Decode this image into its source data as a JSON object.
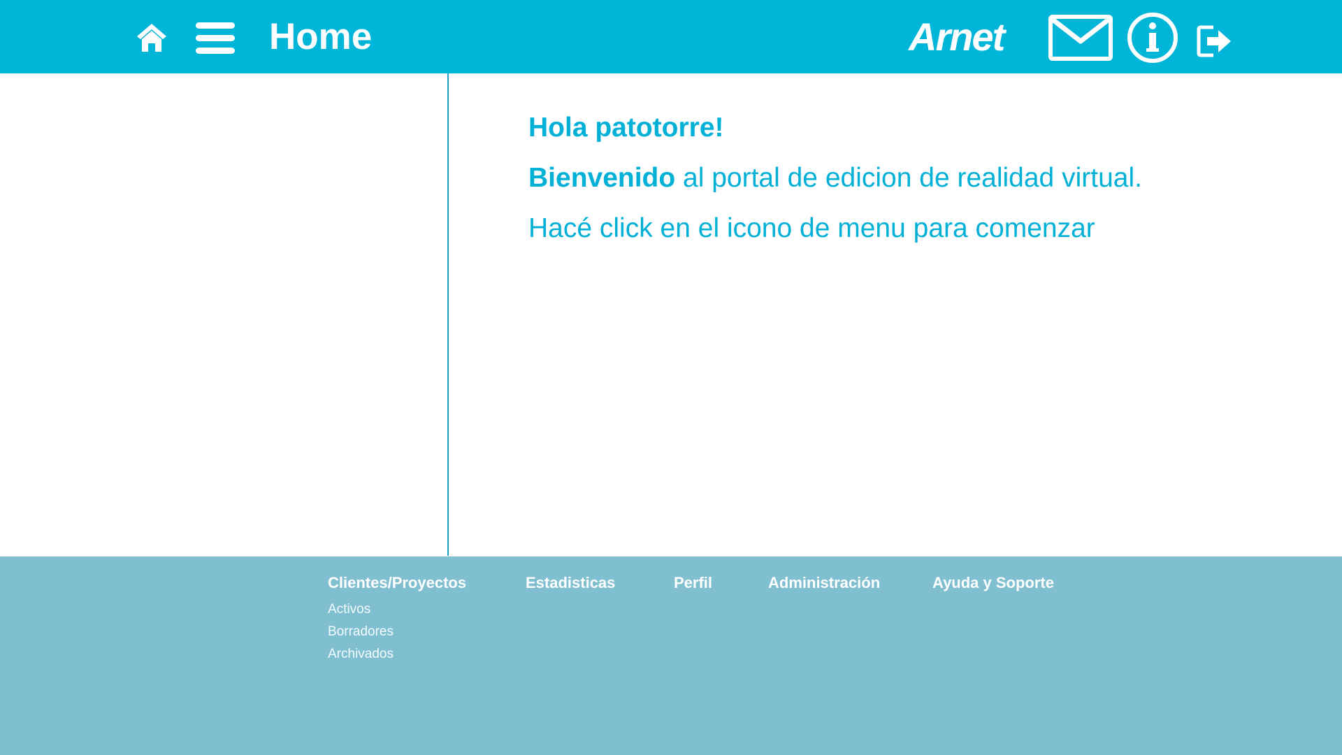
{
  "header": {
    "title": "Home",
    "brand": "Arnet",
    "icons": {
      "home": "home-icon",
      "menu": "hamburger-menu-icon",
      "mail": "mail-icon",
      "info": "info-icon",
      "logout": "logout-icon"
    },
    "background_color": "#00b6d8"
  },
  "main": {
    "greeting": "Hola patotorre!",
    "welcome_bold": "Bienvenido",
    "welcome_rest": " al portal de edicion de realidad virtual.",
    "hint": "Hacé click en el icono de menu para comenzar",
    "text_color": "#00b0d6"
  },
  "footer": {
    "background_color": "#80bfd0",
    "columns": [
      {
        "heading": "Clientes/Proyectos",
        "items": [
          "Activos",
          "Borradores",
          "Archivados"
        ]
      },
      {
        "heading": "Estadisticas",
        "items": []
      },
      {
        "heading": "Perfil",
        "items": []
      },
      {
        "heading": "Administración",
        "items": []
      },
      {
        "heading": "Ayuda y Soporte",
        "items": []
      }
    ]
  }
}
